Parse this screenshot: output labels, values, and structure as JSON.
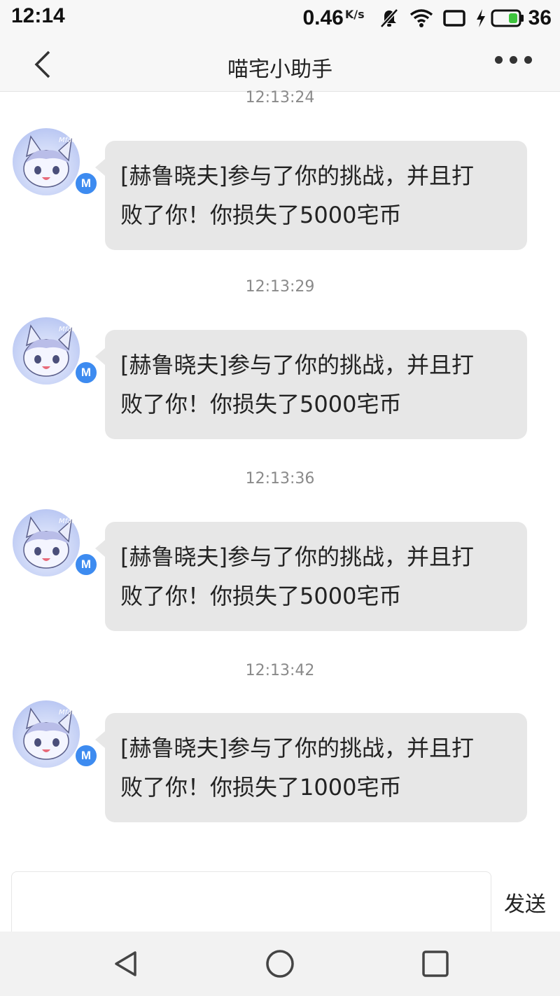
{
  "status_bar": {
    "time": "12:14",
    "net_speed": "0.46",
    "net_unit": "K/s",
    "battery_level": "36",
    "icons": [
      "mute-bell-icon",
      "wifi-icon",
      "screen-icon",
      "charging-icon",
      "battery-icon"
    ]
  },
  "header": {
    "title": "喵宅小助手",
    "back_icon": "chevron-left-icon",
    "more_icon": "more-dots-icon"
  },
  "messages": [
    {
      "timestamp": "12:13:24",
      "badge": "M",
      "text_line1": "[赫鲁晓夫]参与了你的挑战，并且打",
      "text_line2": "败了你！你损失了5000宅币"
    },
    {
      "timestamp": "12:13:29",
      "badge": "M",
      "text_line1": "[赫鲁晓夫]参与了你的挑战，并且打",
      "text_line2": "败了你！你损失了5000宅币"
    },
    {
      "timestamp": "12:13:36",
      "badge": "M",
      "text_line1": "[赫鲁晓夫]参与了你的挑战，并且打",
      "text_line2": "败了你！你损失了5000宅币"
    },
    {
      "timestamp": "12:13:42",
      "badge": "M",
      "text_line1": "[赫鲁晓夫]参与了你的挑战，并且打",
      "text_line2": "败了你！你损失了1000宅币"
    }
  ],
  "input": {
    "value": "",
    "placeholder": "",
    "send_label": "发送"
  },
  "nav": {
    "icons": [
      "back-triangle-icon",
      "home-circle-icon",
      "recents-square-icon"
    ]
  },
  "colors": {
    "bubble": "#e7e7e7",
    "badge": "#3d8bf0",
    "bar_background": "#f7f7f7"
  }
}
